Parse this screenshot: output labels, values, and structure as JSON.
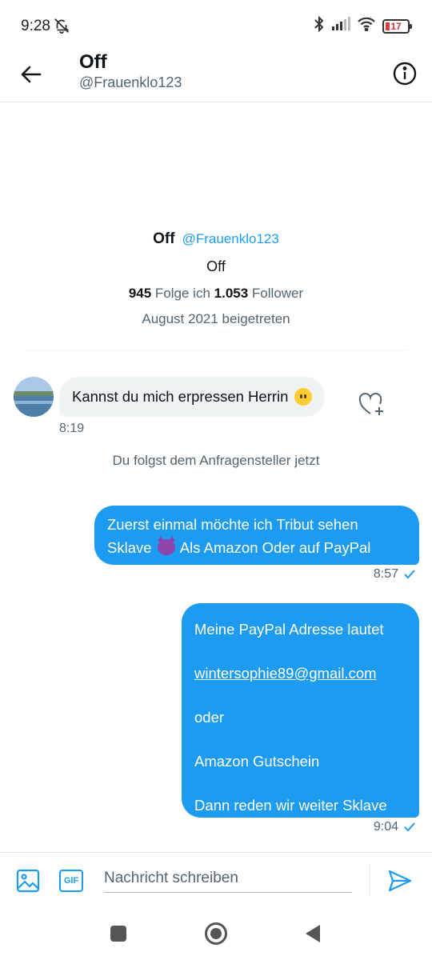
{
  "status_bar": {
    "time": "9:28",
    "battery": "17"
  },
  "header": {
    "title": "Off",
    "handle": "@Frauenklo123"
  },
  "profile": {
    "name": "Off",
    "handle": "@Frauenklo123",
    "bio": "Off",
    "following_count": "945",
    "following_label": "Folge ich",
    "followers_count": "1.053",
    "followers_label": "Follower",
    "joined": "August 2021 beigetreten"
  },
  "messages": {
    "incoming": {
      "text": "Kannst du mich erpressen Herrin",
      "time": "8:19"
    },
    "system_note": "Du folgst dem Anfragensteller jetzt",
    "outgoing_1": {
      "line1": "Zuerst einmal möchte ich Tribut sehen",
      "line2_pre": "Sklave",
      "line2_post": "Als Amazon Oder auf PayPal",
      "time": "8:57"
    },
    "outgoing_2": {
      "line1": "Meine PayPal Adresse lautet",
      "email": "wintersophie89@gmail.com",
      "line3": "oder",
      "line4": "Amazon Gutschein",
      "line5": "Dann reden wir weiter Sklave",
      "time": "9:04"
    }
  },
  "composer": {
    "gif_label": "GIF",
    "placeholder": "Nachricht schreiben"
  },
  "colors": {
    "accent": "#1d9bf0",
    "bubble_in": "#eff3f4",
    "secondary_text": "#536471"
  }
}
